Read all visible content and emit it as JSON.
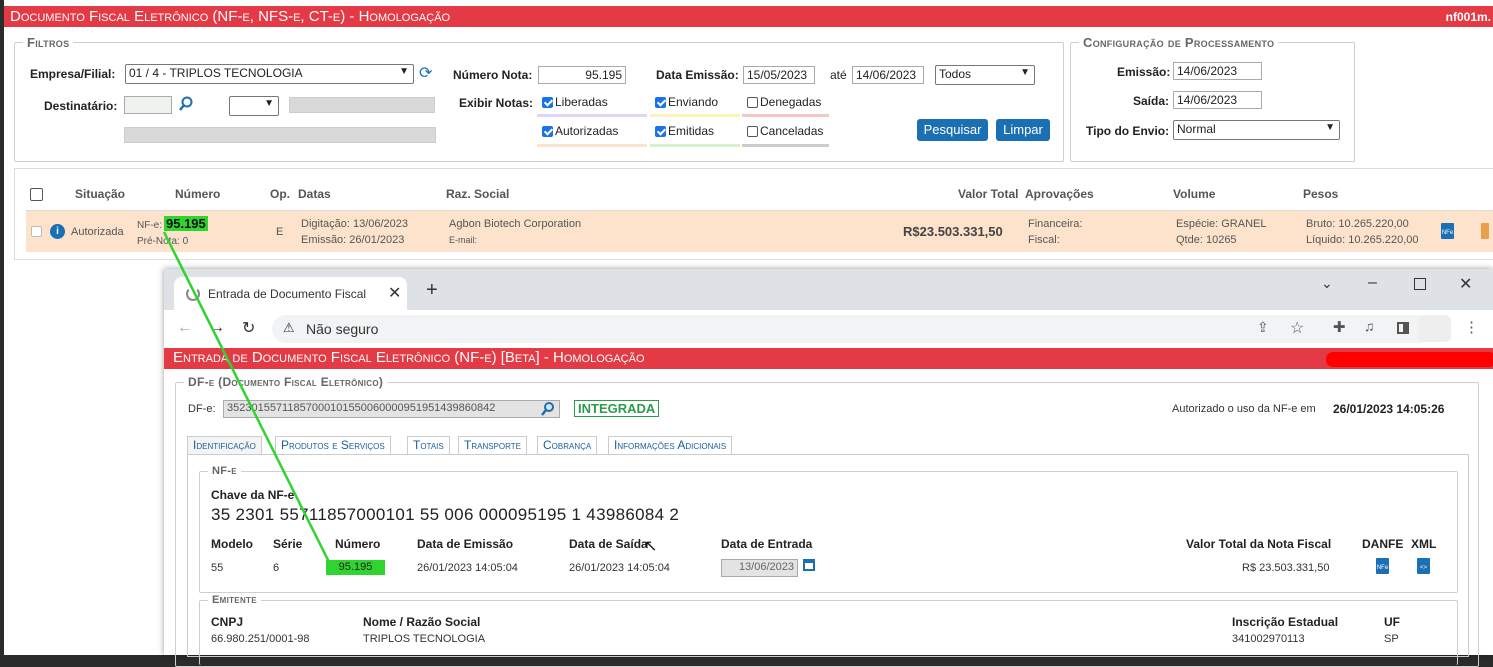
{
  "main_window": {
    "title": "Documento Fiscal Eletrônico (NF-e, NFS-e, CT-e)  - Homologação",
    "code": "nf001m.",
    "filters": {
      "legend": "Filtros",
      "empresa_label": "Empresa/Filial:",
      "empresa_value": "01 / 4 - TRIPLOS TECNOLOGIA",
      "destinatario_label": "Destinatário:",
      "numero_label": "Número Nota:",
      "numero_value": "95.195",
      "data_label": "Data Emissão:",
      "data_de": "15/05/2023",
      "ate_label": "até",
      "data_ate": "14/06/2023",
      "status_select": "Todos",
      "exibir_label": "Exibir Notas:",
      "checks": [
        {
          "label": "Liberadas",
          "checked": true,
          "color": "#dcd6f7"
        },
        {
          "label": "Enviando",
          "checked": true,
          "color": "#f8f3b6"
        },
        {
          "label": "Denegadas",
          "checked": false,
          "color": "#f6c6c6"
        },
        {
          "label": "Autorizadas",
          "checked": true,
          "color": "#fde3cc"
        },
        {
          "label": "Emitidas",
          "checked": true,
          "color": "#d5f2c8"
        },
        {
          "label": "Canceladas",
          "checked": false,
          "color": "#cccccc"
        }
      ],
      "search_button": "Pesquisar",
      "clear_button": "Limpar"
    },
    "config": {
      "legend": "Configuração de Processamento",
      "emissao_label": "Emissão:",
      "emissao_value": "14/06/2023",
      "saida_label": "Saída:",
      "saida_value": "14/06/2023",
      "tipo_label": "Tipo do Envio:",
      "tipo_value": "Normal"
    },
    "table": {
      "headers": [
        "Situação",
        "Número",
        "Op.",
        "Datas",
        "Raz. Social",
        "Valor Total",
        "Aprovações",
        "Volume",
        "Pesos"
      ],
      "row": {
        "situacao": "Autorizada",
        "nfe_label": "NF-e:",
        "numero": "95.195",
        "pre_nota": "Pré-Nota:  0",
        "op": "E",
        "digitacao": "Digitação:  13/06/2023",
        "emissao": "Emissão:  26/01/2023",
        "razao": "Agbon Biotech Corporation",
        "email": "E-mail:",
        "valor": "R$23.503.331,50",
        "financeira": "Financeira:",
        "fiscal": "Fiscal:",
        "especie": "Espécie:  GRANEL",
        "qtde": "Qtde:  10265",
        "bruto": "Bruto:  10.265.220,00",
        "liquido": "Líquido:  10.265.220,00"
      }
    }
  },
  "browser": {
    "tab_title": "Entrada de Documento Fiscal Ele",
    "address_warning": "Não seguro",
    "page_title": "Entrada de Documento Fiscal Eletrônico (NF-e) [Beta]  - Homologação",
    "dfe_legend": "DF-e (Documento Fiscal Eletrônico)",
    "dfe_label": "DF-e:",
    "dfe_key": "35230155711857000101550060000951951439860842",
    "status_badge": "INTEGRADA",
    "authorized_text": "Autorizado o uso da NF-e em",
    "authorized_date": "26/01/2023 14:05:26",
    "tabs": [
      "Identificação",
      "Produtos e Serviços",
      "Totais",
      "Transporte",
      "Cobrança",
      "Informações Adicionais"
    ],
    "nfe_legend": "NF-e",
    "chave_label": "Chave da NF-e",
    "chave_value": "35 2301 55711857000101 55 006 000095195 1 43986084 2",
    "cols": {
      "modelo": "Modelo",
      "serie": "Série",
      "numero": "Número",
      "emissao": "Data de Emissão",
      "saida": "Data de Saída",
      "entrada": "Data de Entrada",
      "valor": "Valor Total da Nota Fiscal",
      "danfe": "DANFE",
      "xml": "XML"
    },
    "vals": {
      "modelo": "55",
      "serie": "6",
      "numero": "95.195",
      "emissao": "26/01/2023 14:05:04",
      "saida": "26/01/2023 14:05:04",
      "entrada": "13/06/2023",
      "valor": "R$ 23.503.331,50"
    },
    "emitente_legend": "Emitente",
    "emit_cols": {
      "cnpj": "CNPJ",
      "nome": "Nome / Razão Social",
      "ie": "Inscrição Estadual",
      "uf": "UF"
    },
    "emit_vals": {
      "cnpj": "66.980.251/0001-98",
      "nome": "TRIPLOS TECNOLOGIA",
      "ie": "341002970113",
      "uf": "SP"
    }
  }
}
